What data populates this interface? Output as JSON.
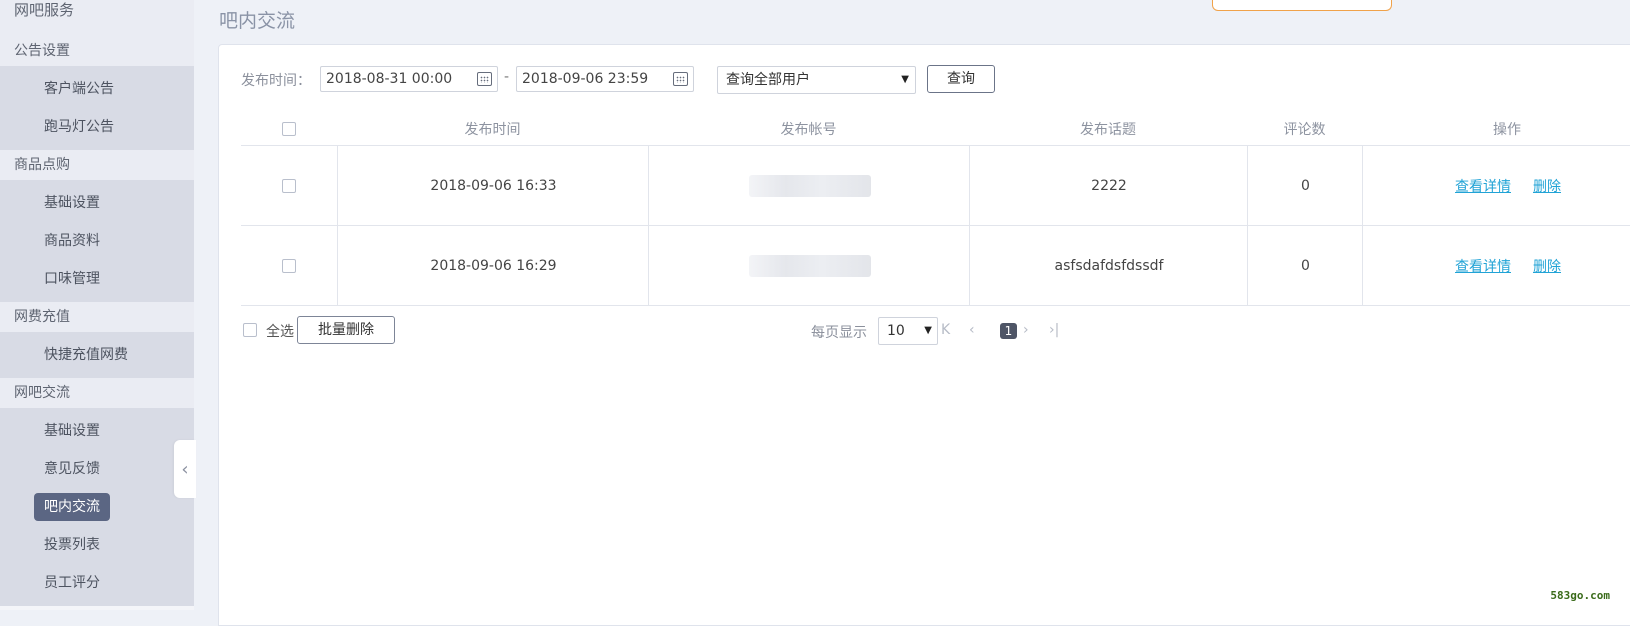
{
  "sidebar": {
    "groups": [
      {
        "title": "网吧服务",
        "items": []
      },
      {
        "title": "公告设置",
        "items": [
          "客户端公告",
          "跑马灯公告"
        ]
      },
      {
        "title": "商品点购",
        "items": [
          "基础设置",
          "商品资料",
          "口味管理"
        ]
      },
      {
        "title": "网费充值",
        "items": [
          "快捷充值网费"
        ]
      },
      {
        "title": "网吧交流",
        "items": [
          "基础设置",
          "意见反馈",
          "吧内交流",
          "投票列表",
          "员工评分"
        ]
      }
    ],
    "active_item": "吧内交流",
    "collapse_icon": "chevron-left-icon"
  },
  "page": {
    "title": "吧内交流"
  },
  "filter": {
    "label": "发布时间：",
    "start": "2018-08-31 00:00",
    "separator": "-",
    "end": "2018-09-06 23:59",
    "user_select": "查询全部用户",
    "query_label": "查询"
  },
  "table": {
    "headers": [
      "发布时间",
      "发布帐号",
      "发布话题",
      "评论数",
      "操作"
    ],
    "rows": [
      {
        "time": "2018-09-06 16:33",
        "topic": "2222",
        "comments": "0"
      },
      {
        "time": "2018-09-06 16:29",
        "topic": "asfsdafdsfdssdf",
        "comments": "0"
      }
    ],
    "actions": {
      "detail": "查看详情",
      "delete": "删除"
    }
  },
  "footer": {
    "select_all": "全选",
    "batch_delete": "批量删除",
    "per_page_label": "每页显示",
    "per_page_value": "10",
    "current_page": "1"
  },
  "watermark": "583go.com"
}
